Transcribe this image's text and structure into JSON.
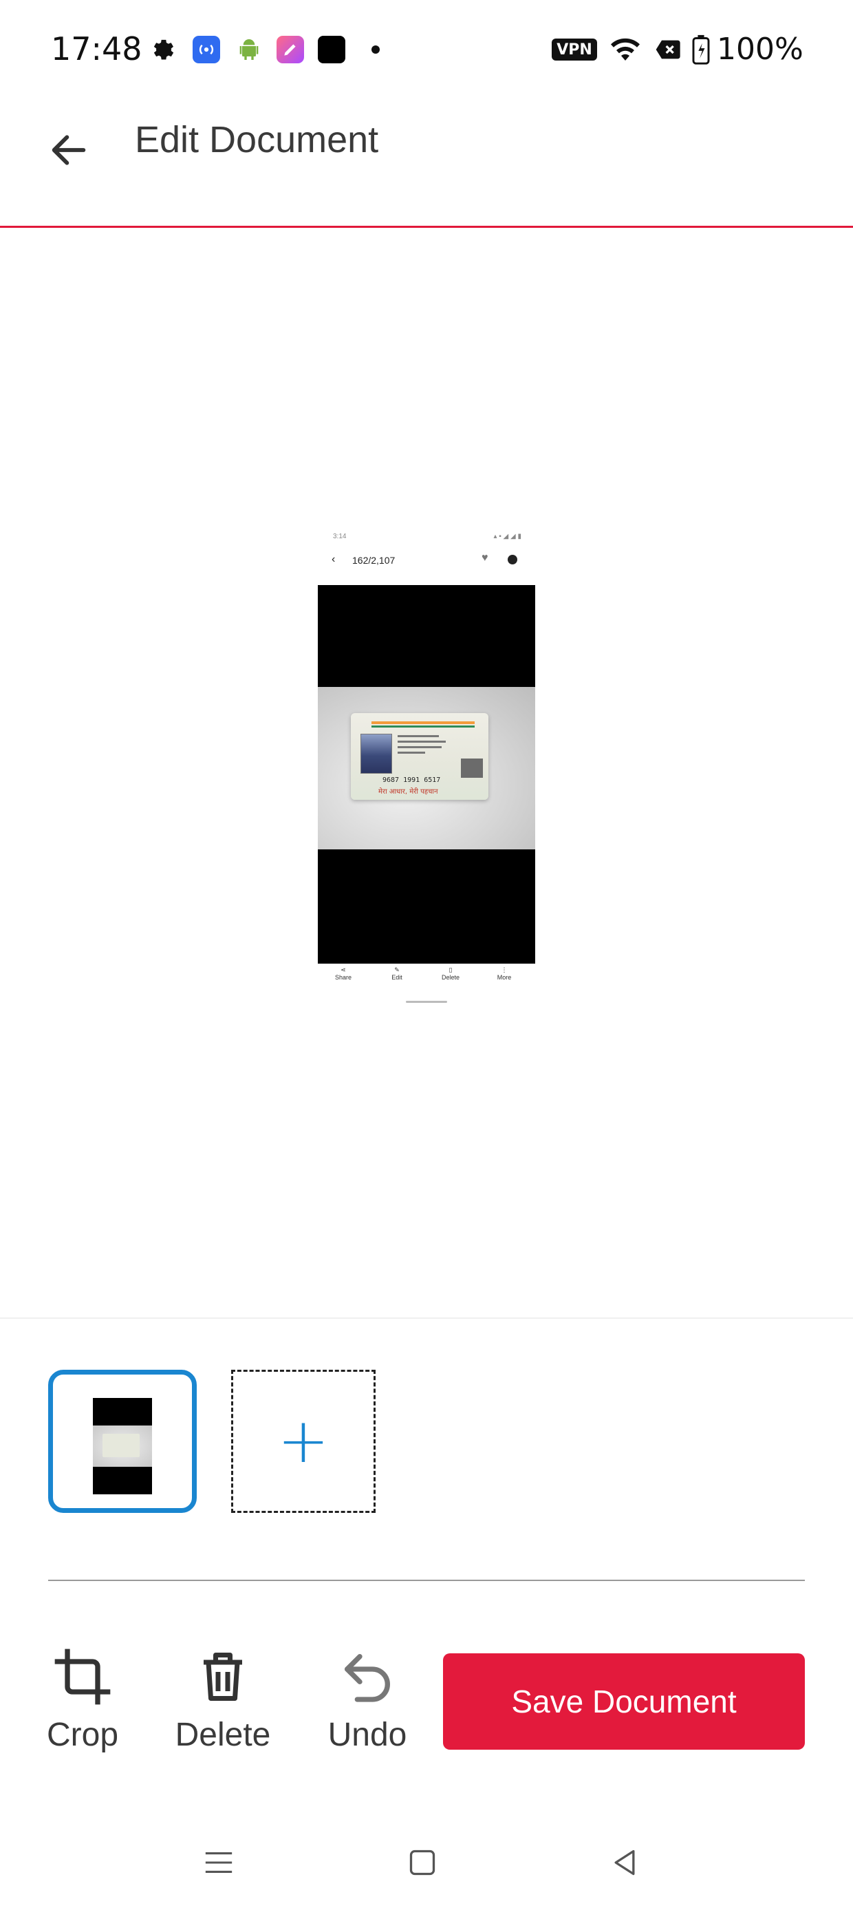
{
  "status_bar": {
    "time": "17:48",
    "icons": [
      "settings-icon",
      "hotspot-icon",
      "android-icon",
      "app-icon",
      "black-app-icon",
      "dot-icon"
    ],
    "vpn_label": "VPN",
    "right_icons": [
      "vpn-icon",
      "wifi-icon",
      "no-sim-icon",
      "battery-icon"
    ],
    "battery": "100%"
  },
  "app_bar": {
    "title": "Edit Document",
    "back_icon": "arrow-left-icon"
  },
  "preview": {
    "statusbar_time": "3:14",
    "header_text": "162/2,107",
    "card_number": "9687 1991 6517",
    "card_tagline": "मेरा आधार, मेरी पहचान",
    "tools": [
      "Share",
      "Edit",
      "Delete",
      "More"
    ]
  },
  "pages": {
    "selected_index": 1,
    "add_label": "+"
  },
  "actions": {
    "crop": "Crop",
    "delete": "Delete",
    "undo": "Undo",
    "save": "Save Document"
  },
  "nav": {
    "menu_icon": "menu-icon",
    "home_icon": "square-home-icon",
    "back_icon": "triangle-back-icon"
  },
  "colors": {
    "accent": "#e31a3c",
    "selection": "#1a86d0",
    "divider": "#e1183a"
  }
}
